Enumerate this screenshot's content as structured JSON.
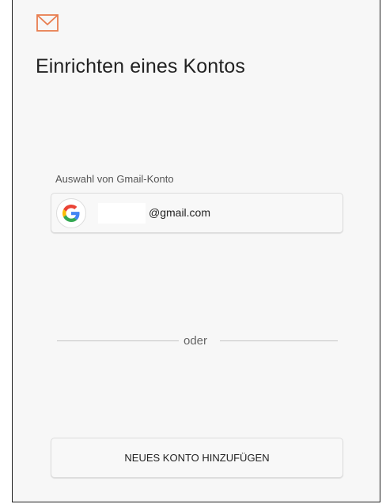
{
  "header": {
    "app_icon": "mail-envelope-icon",
    "accent_color": "#e87d4f",
    "title": "Einrichten eines Kontos"
  },
  "gmail_section": {
    "label": "Auswahl von Gmail-Konto",
    "account": {
      "icon": "google-g-icon",
      "email_suffix": "@gmail.com"
    }
  },
  "divider": {
    "text": "oder"
  },
  "actions": {
    "add_account_label": "NEUES KONTO HINZUFÜGEN"
  }
}
